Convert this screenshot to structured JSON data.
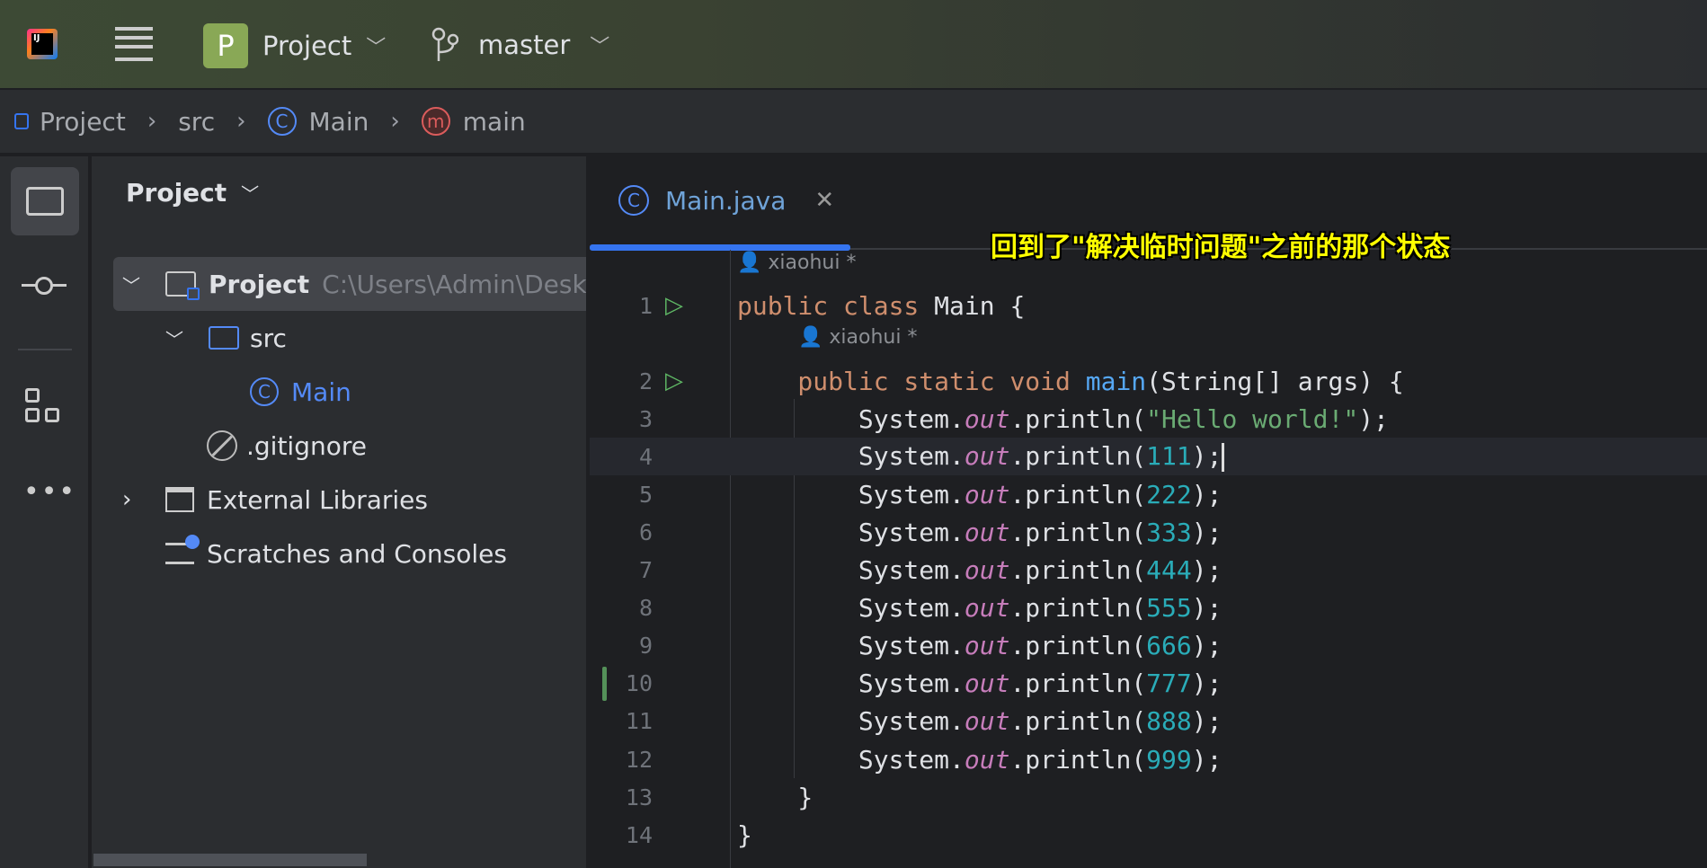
{
  "header": {
    "project_badge": "P",
    "project": "Project",
    "branch": "master"
  },
  "breadcrumb": [
    "Project",
    "src",
    "Main",
    "main"
  ],
  "project_panel": {
    "title": "Project",
    "items": [
      {
        "label": "Project",
        "path": "C:\\Users\\Admin\\Desktop"
      },
      {
        "label": "src"
      },
      {
        "label": "Main"
      },
      {
        "label": ".gitignore"
      },
      {
        "label": "External Libraries"
      },
      {
        "label": "Scratches and Consoles"
      }
    ]
  },
  "editor": {
    "tab": "Main.java",
    "annotation": "回到了\"解决临时问题\"之前的那个状态",
    "author": "xiaohui *",
    "lines": [
      {
        "n": "1",
        "parts": [
          [
            "kw",
            "public class "
          ],
          [
            "",
            "Main {"
          ]
        ]
      },
      {
        "n": "2",
        "parts": [
          [
            "kw",
            "    public static void "
          ],
          [
            "fn",
            "main"
          ],
          [
            "",
            "(String[] args) {"
          ]
        ]
      },
      {
        "n": "3",
        "parts": [
          [
            "",
            "        System."
          ],
          [
            "fi",
            "out"
          ],
          [
            "",
            ".println("
          ],
          [
            "st",
            "\"Hello world!\""
          ],
          [
            "",
            ");"
          ]
        ]
      },
      {
        "n": "4",
        "parts": [
          [
            "",
            "        System."
          ],
          [
            "fi",
            "out"
          ],
          [
            "",
            ".println("
          ],
          [
            "nu",
            "111"
          ],
          [
            "",
            ");"
          ]
        ]
      },
      {
        "n": "5",
        "parts": [
          [
            "",
            "        System."
          ],
          [
            "fi",
            "out"
          ],
          [
            "",
            ".println("
          ],
          [
            "nu",
            "222"
          ],
          [
            "",
            ");"
          ]
        ]
      },
      {
        "n": "6",
        "parts": [
          [
            "",
            "        System."
          ],
          [
            "fi",
            "out"
          ],
          [
            "",
            ".println("
          ],
          [
            "nu",
            "333"
          ],
          [
            "",
            ");"
          ]
        ]
      },
      {
        "n": "7",
        "parts": [
          [
            "",
            "        System."
          ],
          [
            "fi",
            "out"
          ],
          [
            "",
            ".println("
          ],
          [
            "nu",
            "444"
          ],
          [
            "",
            ");"
          ]
        ]
      },
      {
        "n": "8",
        "parts": [
          [
            "",
            "        System."
          ],
          [
            "fi",
            "out"
          ],
          [
            "",
            ".println("
          ],
          [
            "nu",
            "555"
          ],
          [
            "",
            ");"
          ]
        ]
      },
      {
        "n": "9",
        "parts": [
          [
            "",
            "        System."
          ],
          [
            "fi",
            "out"
          ],
          [
            "",
            ".println("
          ],
          [
            "nu",
            "666"
          ],
          [
            "",
            ");"
          ]
        ]
      },
      {
        "n": "10",
        "parts": [
          [
            "",
            "        System."
          ],
          [
            "fi",
            "out"
          ],
          [
            "",
            ".println("
          ],
          [
            "nu",
            "777"
          ],
          [
            "",
            ");"
          ]
        ]
      },
      {
        "n": "11",
        "parts": [
          [
            "",
            "        System."
          ],
          [
            "fi",
            "out"
          ],
          [
            "",
            ".println("
          ],
          [
            "nu",
            "888"
          ],
          [
            "",
            ");"
          ]
        ]
      },
      {
        "n": "12",
        "parts": [
          [
            "",
            "        System."
          ],
          [
            "fi",
            "out"
          ],
          [
            "",
            ".println("
          ],
          [
            "nu",
            "999"
          ],
          [
            "",
            ");"
          ]
        ]
      },
      {
        "n": "13",
        "parts": [
          [
            "",
            "    }"
          ]
        ]
      },
      {
        "n": "14",
        "parts": [
          [
            "",
            "}"
          ]
        ]
      }
    ]
  },
  "colors": {
    "accent": "#3574f0",
    "keyword": "#cf8e6d",
    "number": "#2aacb8",
    "string": "#6aab73",
    "field": "#c77dbb",
    "annotation": "#ffff00"
  }
}
